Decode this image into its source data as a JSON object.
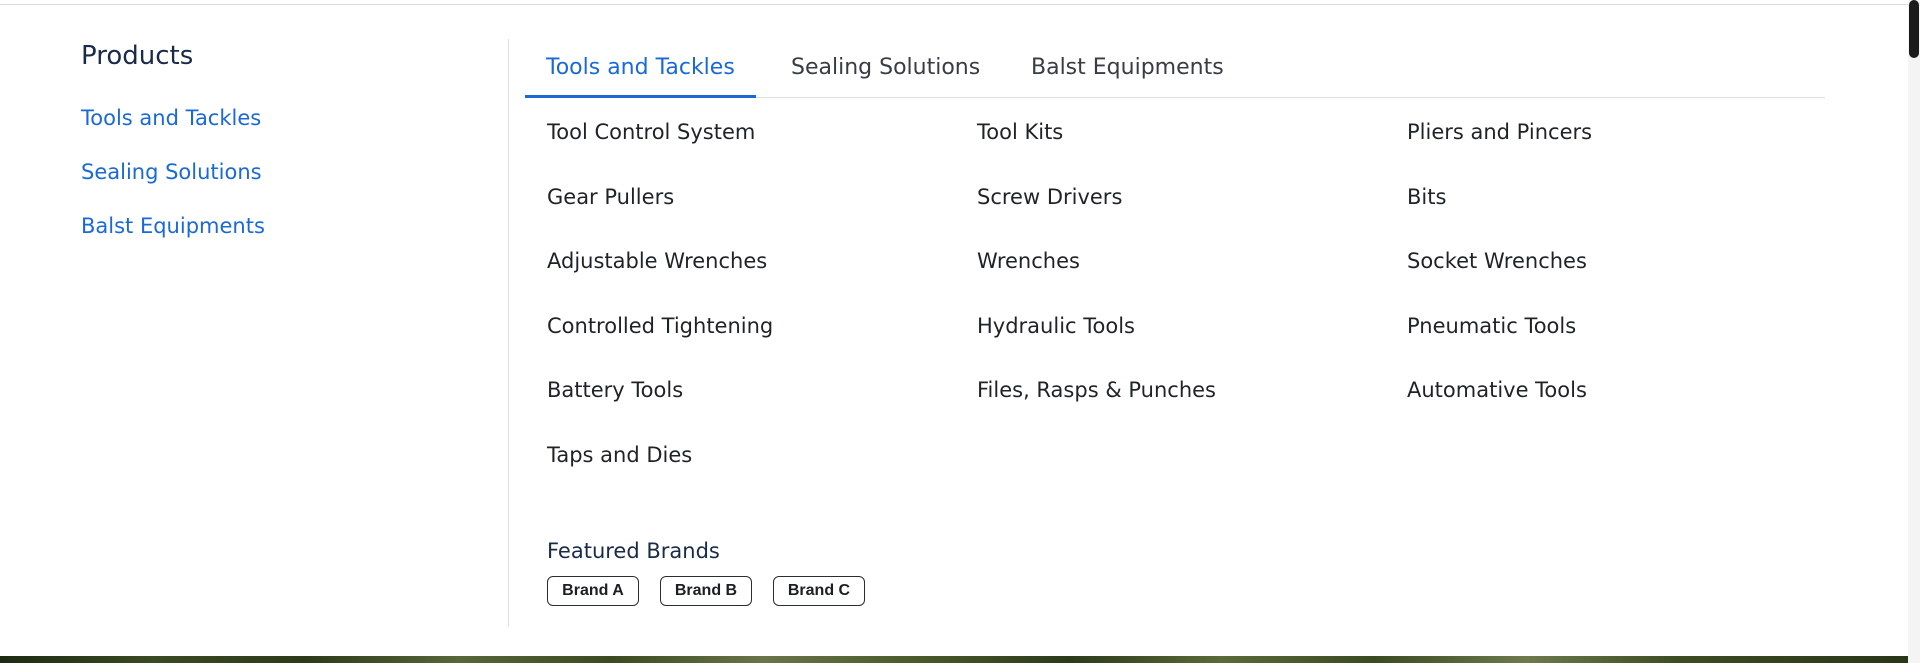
{
  "sidebar": {
    "title": "Products",
    "items": [
      {
        "label": "Tools and Tackles"
      },
      {
        "label": "Sealing Solutions"
      },
      {
        "label": "Balst Equipments"
      }
    ]
  },
  "tabs": [
    {
      "label": "Tools and Tackles",
      "active": true
    },
    {
      "label": "Sealing Solutions",
      "active": false
    },
    {
      "label": "Balst Equipments",
      "active": false
    }
  ],
  "items": [
    "Tool Control System",
    "Tool Kits",
    "Pliers and Pincers",
    "Gear Pullers",
    "Screw Drivers",
    "Bits",
    "Adjustable Wrenches",
    "Wrenches",
    "Socket Wrenches",
    "Controlled Tightening",
    "Hydraulic Tools",
    "Pneumatic Tools",
    "Battery Tools",
    "Files, Rasps & Punches",
    "Automative Tools",
    "Taps and Dies"
  ],
  "featured": {
    "title": "Featured Brands",
    "brands": [
      "Brand A",
      "Brand B",
      "Brand C"
    ]
  },
  "colors": {
    "accent": "#1a6ad6",
    "heading": "#1a2b4a",
    "text": "#1f2328"
  }
}
